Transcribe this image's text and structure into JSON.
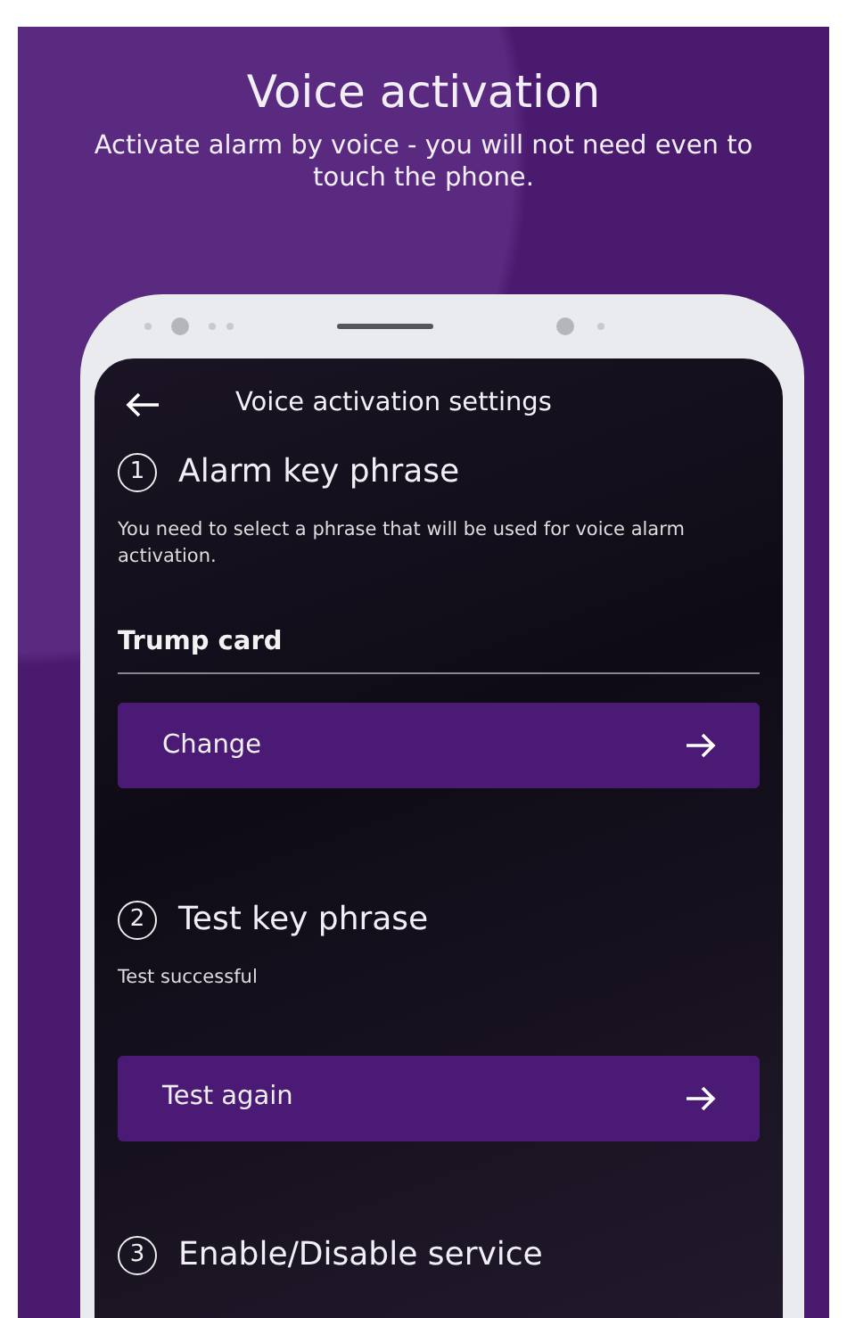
{
  "headline": "Voice activation",
  "subtitle": "Activate alarm by voice - you will not need even to touch the phone.",
  "screen": {
    "title": "Voice activation settings",
    "sections": [
      {
        "number": "1",
        "title": "Alarm key phrase",
        "description": "You need to select a phrase that will be used for voice alarm activation.",
        "field": {
          "value": "Trump card"
        },
        "button": "Change"
      },
      {
        "number": "2",
        "title": "Test key phrase",
        "description": "Test successful",
        "button": "Test again"
      },
      {
        "number": "3",
        "title": "Enable/Disable service"
      }
    ]
  }
}
